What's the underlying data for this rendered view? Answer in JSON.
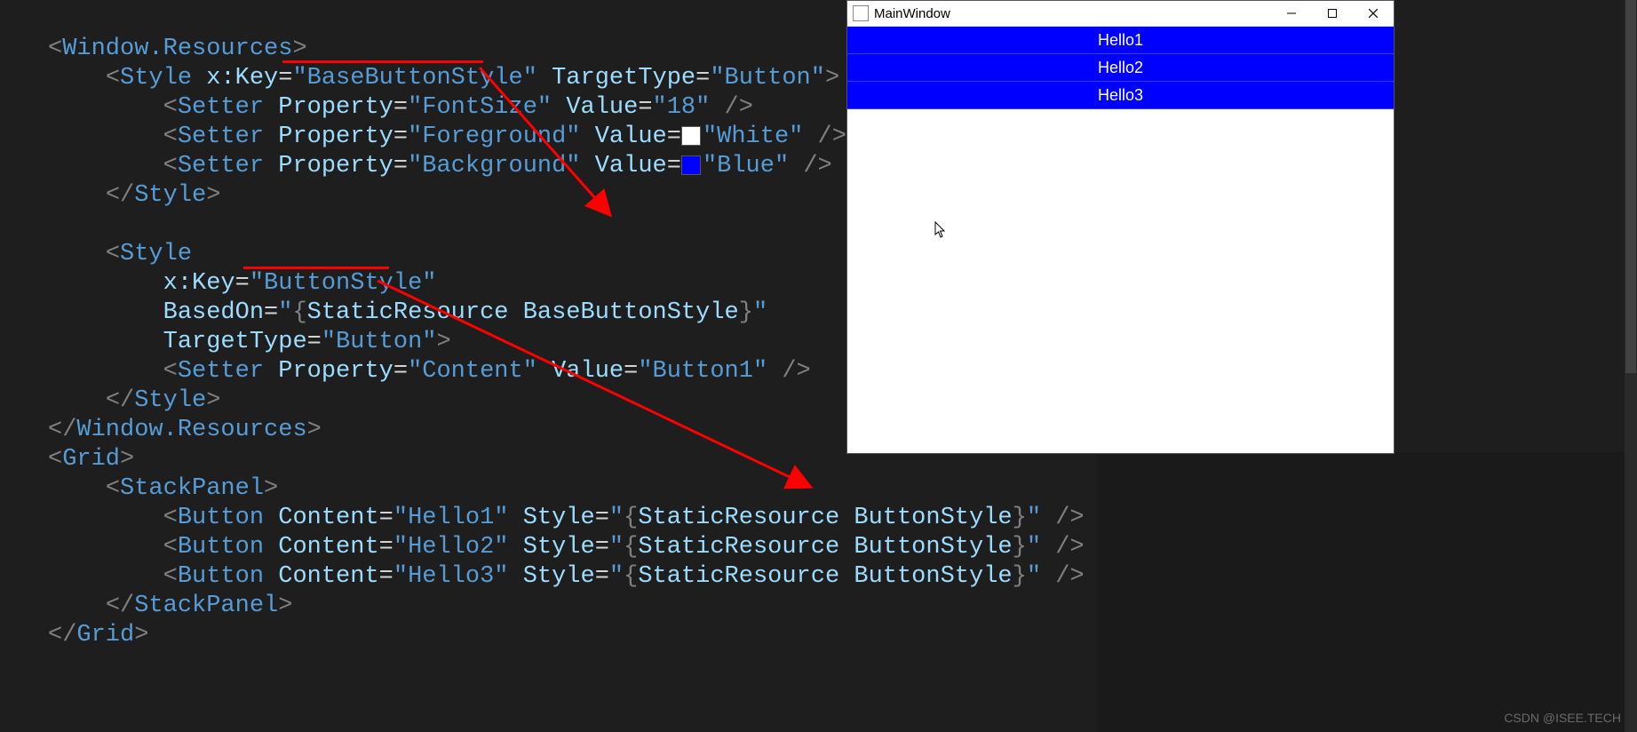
{
  "code": {
    "l1": {
      "tag_open": "<",
      "elem": "Window.Resources",
      "tag_close": ">"
    },
    "l2": {
      "tag_open": "<",
      "elem": "Style ",
      "attr1": "x:Key",
      "eq1": "=",
      "str1": "\"BaseButtonStyle\"",
      "sp": " ",
      "attr2": "TargetType",
      "eq2": "=",
      "str2": "\"Button\"",
      "tag_close": ">"
    },
    "l3": {
      "tag_open": "<",
      "elem": "Setter ",
      "attr1": "Property",
      "eq1": "=",
      "str1": "\"FontSize\"",
      "sp": " ",
      "attr2": "Value",
      "eq2": "=",
      "str2": "\"18\"",
      "tag_close": " />"
    },
    "l4": {
      "tag_open": "<",
      "elem": "Setter ",
      "attr1": "Property",
      "eq1": "=",
      "str1": "\"Foreground\"",
      "sp": " ",
      "attr2": "Value",
      "eq2": "=",
      "str2": "\"White\"",
      "tag_close": " />"
    },
    "l5": {
      "tag_open": "<",
      "elem": "Setter ",
      "attr1": "Property",
      "eq1": "=",
      "str1": "\"Background\"",
      "sp": " ",
      "attr2": "Value",
      "eq2": "=",
      "str2": "\"Blue\"",
      "tag_close": " />"
    },
    "l6": {
      "tag_open": "</",
      "elem": "Style",
      "tag_close": ">"
    },
    "l7": {
      "text": ""
    },
    "l8": {
      "tag_open": "<",
      "elem": "Style"
    },
    "l9": {
      "attr": "x:Key",
      "eq": "=",
      "str": "\"ButtonStyle\""
    },
    "l10": {
      "attr": "BasedOn",
      "eq": "=",
      "q": "\"",
      "brace_open": "{",
      "res": "StaticResource BaseButtonStyle",
      "brace_close": "}",
      "q2": "\""
    },
    "l11": {
      "attr": "TargetType",
      "eq": "=",
      "str": "\"Button\"",
      "tag_close": ">"
    },
    "l12": {
      "tag_open": "<",
      "elem": "Setter ",
      "attr1": "Property",
      "eq1": "=",
      "str1": "\"Content\"",
      "sp": " ",
      "attr2": "Value",
      "eq2": "=",
      "str2": "\"Button1\"",
      "tag_close": " />"
    },
    "l13": {
      "tag_open": "</",
      "elem": "Style",
      "tag_close": ">"
    },
    "l14": {
      "tag_open": "</",
      "elem": "Window.Resources",
      "tag_close": ">"
    },
    "l15": {
      "tag_open": "<",
      "elem": "Grid",
      "tag_close": ">"
    },
    "l16": {
      "tag_open": "<",
      "elem": "StackPanel",
      "tag_close": ">"
    },
    "l17": {
      "tag_open": "<",
      "elem": "Button ",
      "attr1": "Content",
      "eq1": "=",
      "str1": "\"Hello1\"",
      "sp": " ",
      "attr2": "Style",
      "eq2": "=",
      "q": "\"",
      "brace_open": "{",
      "res": "StaticResource ButtonStyle",
      "brace_close": "}",
      "q2": "\"",
      "tag_close": " />"
    },
    "l18": {
      "tag_open": "<",
      "elem": "Button ",
      "attr1": "Content",
      "eq1": "=",
      "str1": "\"Hello2\"",
      "sp": " ",
      "attr2": "Style",
      "eq2": "=",
      "q": "\"",
      "brace_open": "{",
      "res": "StaticResource ButtonStyle",
      "brace_close": "}",
      "q2": "\"",
      "tag_close": " />"
    },
    "l19": {
      "tag_open": "<",
      "elem": "Button ",
      "attr1": "Content",
      "eq1": "=",
      "str1": "\"Hello3\"",
      "sp": " ",
      "attr2": "Style",
      "eq2": "=",
      "q": "\"",
      "brace_open": "{",
      "res": "StaticResource ButtonStyle",
      "brace_close": "}",
      "q2": "\"",
      "tag_close": " />"
    },
    "l20": {
      "tag_open": "</",
      "elem": "StackPanel",
      "tag_close": ">"
    },
    "l21": {
      "tag_open": "</",
      "elem": "Grid",
      "tag_close": ">"
    }
  },
  "window": {
    "title": "MainWindow",
    "buttons": [
      "Hello1",
      "Hello2",
      "Hello3"
    ]
  },
  "watermark": "CSDN @ISEE.TECH"
}
